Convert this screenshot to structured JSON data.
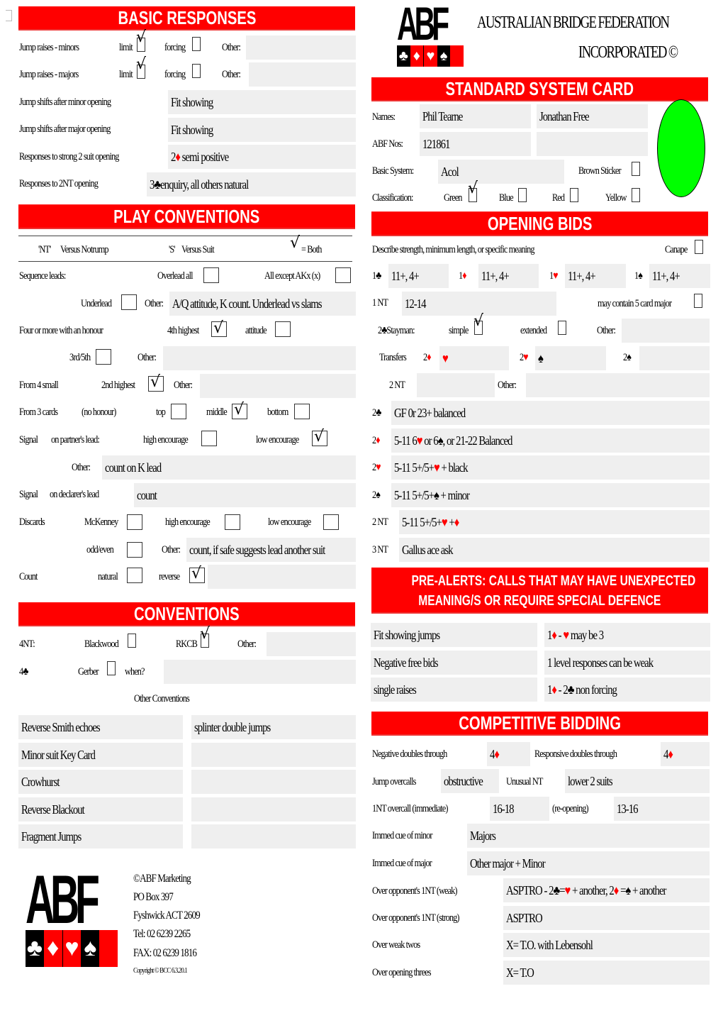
{
  "basic_responses": {
    "title": "BASIC RESPONSES",
    "jump_raises_minors": {
      "label": "Jump raises - minors",
      "limit_label": "limit",
      "limit_checked": true,
      "forcing_label": "forcing",
      "forcing_checked": false,
      "other_label": "Other:",
      "other_value": ""
    },
    "jump_raises_majors": {
      "label": "Jump raises - majors",
      "limit_label": "limit",
      "limit_checked": true,
      "forcing_label": "forcing",
      "forcing_checked": false,
      "other_label": "Other:",
      "other_value": ""
    },
    "jump_shifts_minor": {
      "label": "Jump shifts after minor opening",
      "value": "Fit showing"
    },
    "jump_shifts_major": {
      "label": "Jump shifts after major opening",
      "value": "Fit showing"
    },
    "strong_two": {
      "label": "Responses to strong 2 suit opening",
      "value_prefix": "2",
      "value_suit": "♦",
      "value_rest": " semi positive"
    },
    "two_nt": {
      "label": "Responses to 2NT opening",
      "value_prefix": "3",
      "value_suit": "♣",
      "value_rest": "enquiry, all others natural"
    }
  },
  "header": {
    "org_line1": "AUSTRALIAN BRIDGE FEDERATION",
    "org_line2": "INCORPORATED ©",
    "logo_text": "ABF"
  },
  "system_card": {
    "title": "STANDARD SYSTEM CARD",
    "names_label": "Names:",
    "name1": "Phil Tearne",
    "name2": "Jonathan Free",
    "abf_nos_label": "ABF Nos:",
    "abf_no1": "121861",
    "abf_no2": "",
    "basic_system_label": "Basic System:",
    "basic_system": "Acol",
    "brown_sticker_label": "Brown Sticker",
    "brown_sticker_checked": false,
    "classification_label": "Classification:",
    "classifications": [
      {
        "label": "Green",
        "checked": true
      },
      {
        "label": "Blue",
        "checked": false
      },
      {
        "label": "Red",
        "checked": false
      },
      {
        "label": "Yellow",
        "checked": false
      }
    ],
    "classification_color": "#00ff00"
  },
  "play_conventions": {
    "title": "PLAY CONVENTIONS",
    "legend_nt": "'NT'",
    "legend_nt_desc": "Versus Notrump",
    "legend_s": "'S'",
    "legend_s_desc": "Versus Suit",
    "legend_both": "= Both",
    "sequence_leads_label": "Sequence leads:",
    "overlead_all": "Overlead all",
    "all_except": "All except AKx (x)",
    "underlead": "Underlead",
    "other_label": "Other:",
    "sequence_other": "A/Q attitude, K count. Underlead vs slams",
    "four_or_more_label": "Four or more with an honour",
    "fourth_highest": "4th highest",
    "fourth_highest_checked": true,
    "attitude": "attitude",
    "third_fifth": "3rd/5th",
    "four_other": "",
    "from4small_label": "From 4 small",
    "second_highest": "2nd highest",
    "second_highest_checked": true,
    "from4small_other": "",
    "from3_label": "From 3 cards",
    "no_honour": "(no honour)",
    "top": "top",
    "middle": "middle",
    "middle_checked": true,
    "bottom": "bottom",
    "signal_label": "Signal",
    "partners_lead": "on partner's lead:",
    "high_encourage": "high encourage",
    "low_encourage": "low encourage",
    "partner_low_checked": true,
    "partner_other": "count on K lead",
    "declarers_lead": "on declarer's lead",
    "declarer_value": "count",
    "discards_label": "Discards",
    "mckenney": "McKenney",
    "odd_even": "odd/even",
    "discards_other": "count, if safe suggests lead another suit",
    "count_label": "Count",
    "natural": "natural",
    "reverse": "reverse",
    "reverse_checked": true,
    "count_other": ""
  },
  "conventions": {
    "title": "CONVENTIONS",
    "fournt_label": "4NT:",
    "blackwood": "Blackwood",
    "blackwood_checked": false,
    "rkcb": "RKCB",
    "rkcb_checked": true,
    "other_label": "Other:",
    "fournt_other": "",
    "fourclub_prefix": "4",
    "fourclub_suit": "♣",
    "gerber": "Gerber",
    "gerber_checked": false,
    "when": "when?",
    "when_value": "",
    "other_conventions_label": "Other Conventions",
    "left_list": [
      "Reverse Smith echoes",
      "Minor suit Key Card",
      "Crowhurst",
      "Reverse Blackout",
      "Fragment Jumps"
    ],
    "right_list": [
      "splinter double jumps",
      "",
      "",
      "",
      ""
    ]
  },
  "opening_bids": {
    "title": "OPENING BIDS",
    "describe": "Describe strength, minimum length, or specific meaning",
    "canape": "Canape",
    "canape_checked": false,
    "one_level": [
      {
        "level": "1",
        "suit": "♣",
        "red": false,
        "value": "11+, 4+"
      },
      {
        "level": "1",
        "suit": "♦",
        "red": true,
        "value": "11+, 4+"
      },
      {
        "level": "1",
        "suit": "♥",
        "red": true,
        "value": "11+, 4+"
      },
      {
        "level": "1",
        "suit": "♠",
        "red": false,
        "value": "11+, 4+"
      }
    ],
    "onent_label": "1 NT",
    "onent_value": "12-14",
    "five_card_major": "may contain 5 card major",
    "five_card_major_checked": false,
    "stayman_prefix": "2",
    "stayman_suit": "♣",
    "stayman_label": "Stayman:",
    "simple": "simple",
    "simple_checked": true,
    "extended": "extended",
    "extended_checked": false,
    "other_label": "Other:",
    "stayman_other": "",
    "transfers_label": "Transfers",
    "transfers": [
      {
        "bid": "2",
        "bid_suit": "♦",
        "bid_red": true,
        "to_suit": "♥",
        "to_red": true
      },
      {
        "bid": "2",
        "bid_suit": "♥",
        "bid_red": true,
        "to_suit": "♠",
        "to_red": false
      },
      {
        "bid": "2",
        "bid_suit": "♠",
        "bid_red": false,
        "to_suit": "",
        "to_red": false
      }
    ],
    "twont_label": "2 NT",
    "twont_value": "",
    "twont_other": "",
    "two_level": [
      {
        "bid": "2",
        "suit": "♣",
        "red": false,
        "value": "GF 0r 23+ balanced"
      },
      {
        "bid": "2",
        "suit": "♦",
        "red": true,
        "value": "5-11 6♥ or 6♠, or 21-22 Balanced"
      },
      {
        "bid": "2",
        "suit": "♥",
        "red": true,
        "value": "5-11 5+/5+♥ + black"
      },
      {
        "bid": "2",
        "suit": "♠",
        "red": false,
        "value": "5-11 5+/5+♠ + minor"
      }
    ],
    "twont_row_label": "2 NT",
    "twont_row_value": "5-11 5+/5+♥ +♦",
    "threent_label": "3 NT",
    "threent_value": "Gallus ace ask"
  },
  "pre_alerts": {
    "title_line1": "PRE-ALERTS: CALLS THAT MAY HAVE UNEXPECTED",
    "title_line2": "MEANING/S OR REQUIRE SPECIAL DEFENCE",
    "left": [
      "Fit showing jumps",
      "Negative free bids",
      "single raises"
    ],
    "right": [
      "1♦ - ♥ may be 3",
      "1 level responses can be weak",
      "1♦ - 2♣ non forcing"
    ]
  },
  "competitive": {
    "title": "COMPETITIVE BIDDING",
    "neg_doubles_label": "Negative doubles through",
    "neg_doubles_value": "4♦",
    "resp_doubles_label": "Responsive doubles through",
    "resp_doubles_value": "4♦",
    "jump_overcalls_label": "Jump overcalls",
    "jump_overcalls_value": "obstructive",
    "unusual_nt_label": "Unusual NT",
    "unusual_nt_value": "lower 2 suits",
    "nt_overcall_label": "1NT overcall (immediate)",
    "nt_overcall_value": "16-18",
    "reopening_label": "(re-opening)",
    "reopening_value": "13-16",
    "cue_minor_label": "Immed cue of minor",
    "cue_minor_value": "Majors",
    "cue_major_label": "Immed cue of major",
    "cue_major_value": "Other major + Minor",
    "weak_nt_label": "Over opponent's 1NT (weak)",
    "weak_nt_value": "ASPTRO - 2♣=♥ + another, 2♦ =♠ + another",
    "strong_nt_label": "Over opponent's 1NT (strong)",
    "strong_nt_value": "ASPTRO",
    "weak_twos_label": "Over weak twos",
    "weak_twos_value": "X= T.O. with Lebensohl",
    "threes_label": "Over opening threes",
    "threes_value": "X= T.O"
  },
  "footer": {
    "lines": [
      "©ABF Marketing",
      "PO Box 397",
      "Fyshwick ACT 2609",
      "Tel: 02 6239 2265",
      "FAX: 02 6239 1816"
    ],
    "copyright": "Copyright © BCC 6.3.20.1"
  }
}
